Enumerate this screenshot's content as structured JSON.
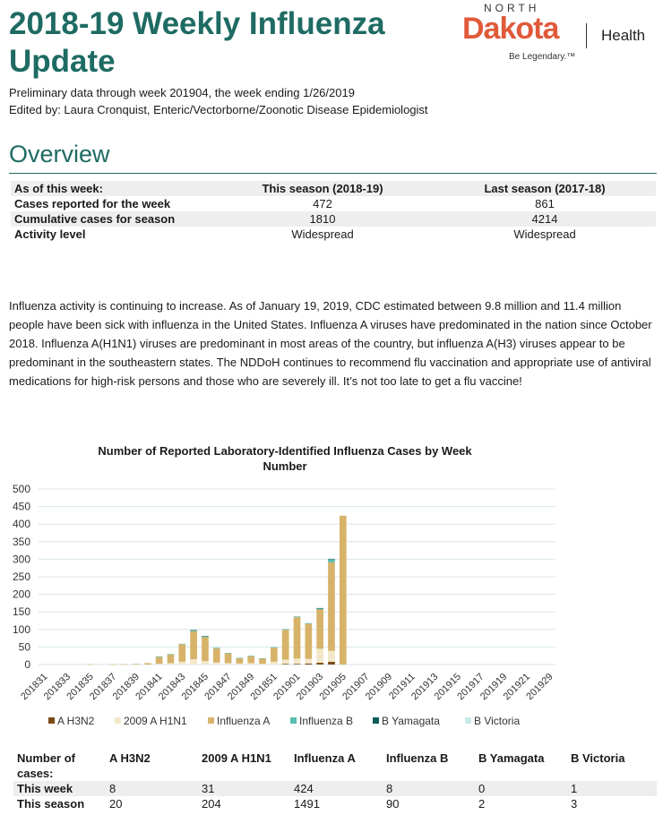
{
  "header": {
    "title": "2018-19 Weekly Influenza Update",
    "subtitle": "Preliminary data through week 201904, the week ending 1/26/2019",
    "editor": "Edited by: Laura Cronquist, Enteric/Vectorborne/Zoonotic Disease Epidemiologist"
  },
  "logo": {
    "north": "NORTH",
    "dakota": "Dakota",
    "health": "Health",
    "tagline": "Be Legendary.™",
    "color": "#e05a3a"
  },
  "overview": {
    "heading": "Overview",
    "columns": [
      "As of this week:",
      "This season (2018-19)",
      "Last season (2017-18)"
    ],
    "rows": [
      {
        "label": "Cases reported for the week",
        "this": "472",
        "last": "861"
      },
      {
        "label": "Cumulative cases for season",
        "this": "1810",
        "last": "4214"
      },
      {
        "label": "Activity level",
        "this": "Widespread",
        "last": "Widespread"
      }
    ]
  },
  "paragraph": "Influenza activity is continuing to increase. As of January 19, 2019, CDC estimated between 9.8 million and 11.4 million people have been sick with influenza in the United States. Influenza A viruses have predominated in the nation since October 2018. Influenza A(H1N1) viruses are predominant in most areas of the country, but influenza A(H3) viruses appear to be predominant in the southeastern states. The NDDoH continues to recommend flu vaccination and appropriate use of antiviral medications for high-risk persons and those who are severely ill. It’s not too late to get a flu vaccine!",
  "chart_data": {
    "type": "bar",
    "stacked": true,
    "title": "Number of Reported Laboratory-Identified Influenza Cases by Week Number",
    "ylim": [
      0,
      500
    ],
    "yticks": [
      0,
      50,
      100,
      150,
      200,
      250,
      300,
      350,
      400,
      450,
      500
    ],
    "grid": true,
    "legend": "bottom",
    "categories": [
      "201831",
      "201832",
      "201833",
      "201834",
      "201835",
      "201836",
      "201837",
      "201838",
      "201839",
      "201840",
      "201841",
      "201842",
      "201843",
      "201844",
      "201845",
      "201846",
      "201847",
      "201848",
      "201849",
      "201850",
      "201851",
      "201852",
      "201901",
      "201902",
      "201903",
      "201904",
      "201905",
      "201906",
      "201907",
      "201908",
      "201909",
      "201910",
      "201911",
      "201912",
      "201913",
      "201914",
      "201915",
      "201916",
      "201917",
      "201918",
      "201919",
      "201920",
      "201921",
      "201922",
      "201929"
    ],
    "tick_labels": [
      "201831",
      "201833",
      "201835",
      "201837",
      "201839",
      "201841",
      "201843",
      "201845",
      "201847",
      "201849",
      "201851",
      "201901",
      "201903",
      "201905",
      "201907",
      "201909",
      "201911",
      "201913",
      "201915",
      "201917",
      "201919",
      "201921",
      "201929"
    ],
    "series": [
      {
        "name": "A H3N2",
        "color": "#7a4b14",
        "values": [
          0,
          0,
          0,
          0,
          0,
          0,
          0,
          0,
          0,
          0,
          0,
          0,
          0,
          0,
          0,
          0,
          0,
          0,
          0,
          0,
          0,
          2,
          2,
          3,
          5,
          8,
          0,
          0,
          0,
          0,
          0,
          0,
          0,
          0,
          0,
          0,
          0,
          0,
          0,
          0,
          0,
          0,
          0,
          0,
          0
        ]
      },
      {
        "name": "2009 A H1N1",
        "color": "#f3e7c9",
        "values": [
          0,
          0,
          0,
          0,
          0,
          0,
          0,
          0,
          0,
          0,
          2,
          4,
          8,
          15,
          10,
          6,
          4,
          3,
          4,
          2,
          8,
          12,
          15,
          13,
          40,
          31,
          0,
          0,
          0,
          0,
          0,
          0,
          0,
          0,
          0,
          0,
          0,
          0,
          0,
          0,
          0,
          0,
          0,
          0,
          0
        ]
      },
      {
        "name": "Influenza A",
        "color": "#d7b36a",
        "values": [
          0,
          0,
          0,
          0,
          1,
          0,
          1,
          1,
          2,
          4,
          20,
          25,
          50,
          80,
          68,
          40,
          28,
          15,
          20,
          15,
          40,
          85,
          118,
          100,
          112,
          252,
          424,
          0,
          0,
          0,
          0,
          0,
          0,
          0,
          0,
          0,
          0,
          0,
          0,
          0,
          0,
          0,
          0,
          0,
          0
        ]
      },
      {
        "name": "Influenza B",
        "color": "#5bbcb0",
        "values": [
          0,
          0,
          0,
          0,
          0,
          0,
          0,
          0,
          0,
          0,
          1,
          1,
          1,
          2,
          2,
          2,
          1,
          1,
          1,
          1,
          2,
          2,
          2,
          2,
          3,
          8,
          0,
          0,
          0,
          0,
          0,
          0,
          0,
          0,
          0,
          0,
          0,
          0,
          0,
          0,
          0,
          0,
          0,
          0,
          0
        ]
      },
      {
        "name": "B Yamagata",
        "color": "#0d5e55",
        "values": [
          0,
          0,
          0,
          0,
          0,
          0,
          0,
          0,
          0,
          0,
          0,
          0,
          0,
          1,
          1,
          0,
          0,
          0,
          0,
          0,
          0,
          0,
          0,
          0,
          1,
          2,
          0,
          0,
          0,
          0,
          0,
          0,
          0,
          0,
          0,
          0,
          0,
          0,
          0,
          0,
          0,
          0,
          0,
          0,
          0
        ]
      },
      {
        "name": "B Victoria",
        "color": "#c6e9e4",
        "values": [
          0,
          0,
          0,
          0,
          0,
          0,
          0,
          0,
          0,
          0,
          0,
          0,
          1,
          0,
          0,
          1,
          0,
          0,
          0,
          0,
          1,
          0,
          0,
          0,
          1,
          1,
          0,
          0,
          0,
          0,
          0,
          0,
          0,
          0,
          0,
          0,
          0,
          0,
          0,
          0,
          0,
          0,
          0,
          0,
          0
        ]
      }
    ]
  },
  "cases_table": {
    "headers": [
      "Number of cases:",
      "A H3N2",
      "2009 A H1N1",
      "Influenza A",
      "Influenza B",
      "B Yamagata",
      "B Victoria"
    ],
    "rows": [
      {
        "label": "This week",
        "values": [
          "8",
          "31",
          "424",
          "8",
          "0",
          "1"
        ]
      },
      {
        "label": "This season",
        "values": [
          "20",
          "204",
          "1491",
          "90",
          "2",
          "3"
        ]
      }
    ]
  }
}
